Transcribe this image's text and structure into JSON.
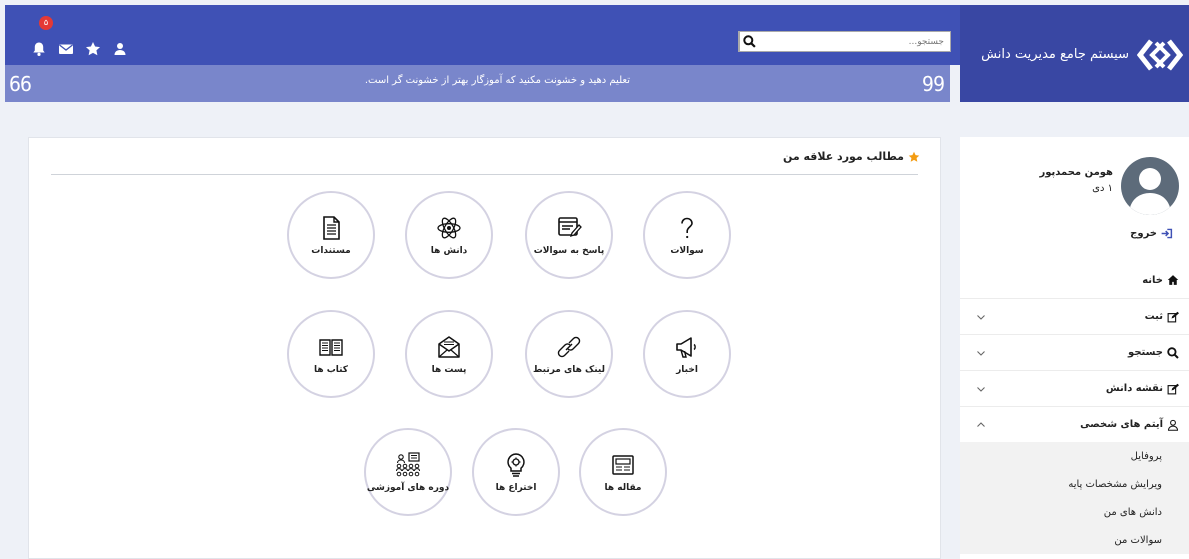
{
  "brand": {
    "title": "سیستم جامع مدیریت دانش"
  },
  "search": {
    "placeholder": "جستجو..."
  },
  "header": {
    "notification_count": "۵"
  },
  "quote": {
    "open": "66",
    "close": "99",
    "text": "تعلیم دهید و خشونت مکنید که آموزگار بهتر از خشونت گر است."
  },
  "favorites": {
    "title": "مطالب مورد علاقه من",
    "tiles": [
      {
        "label": "سوالات",
        "icon": "question-icon"
      },
      {
        "label": "پاسخ به سوالات",
        "icon": "answer-window-icon"
      },
      {
        "label": "دانش ها",
        "icon": "atom-icon"
      },
      {
        "label": "مستندات",
        "icon": "document-icon"
      },
      {
        "label": "اخبار",
        "icon": "megaphone-icon"
      },
      {
        "label": "لینک های مرتبط",
        "icon": "link-icon"
      },
      {
        "label": "پست ها",
        "icon": "envelope-icon"
      },
      {
        "label": "کتاب ها",
        "icon": "book-icon"
      },
      {
        "label": "مقاله ها",
        "icon": "newspaper-icon"
      },
      {
        "label": "اختراع ها",
        "icon": "lightbulb-icon"
      },
      {
        "label": "دوره های آموزشی",
        "icon": "training-group-icon"
      }
    ]
  },
  "user": {
    "name": "هومن محمدپور",
    "date": "۱ دی",
    "logout": "خروج"
  },
  "menu": [
    {
      "label": "خانه",
      "icon": "home-icon"
    },
    {
      "label": "ثبت",
      "icon": "edit-icon"
    },
    {
      "label": "جستجو",
      "icon": "search-icon"
    },
    {
      "label": "نقشه دانش",
      "icon": "edit-icon"
    },
    {
      "label": "آیتم های شخصی",
      "icon": "user-outline-icon"
    }
  ],
  "submenu": [
    {
      "label": "پروفایل"
    },
    {
      "label": "ویرایش مشخصات پایه"
    },
    {
      "label": "دانش های من"
    },
    {
      "label": "سوالات من"
    }
  ],
  "colors": {
    "header": "#3f51b5",
    "brand": "#3947a3",
    "quote_bar": "#7986cb",
    "star": "#f39c12",
    "logout_icon": "#3f51b5"
  }
}
